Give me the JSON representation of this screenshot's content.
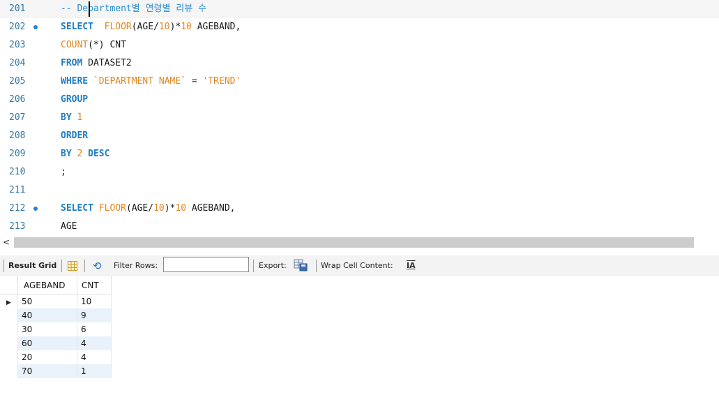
{
  "editor": {
    "lines": [
      {
        "no": "201",
        "marker": false,
        "current": true,
        "tokens": [
          {
            "t": "cm",
            "v": "-- Department별 연령별 리뷰 수"
          }
        ]
      },
      {
        "no": "202",
        "marker": true,
        "current": false,
        "tokens": [
          {
            "t": "kw",
            "v": "SELECT"
          },
          {
            "t": "id",
            "v": "  "
          },
          {
            "t": "fn",
            "v": "FLOOR"
          },
          {
            "t": "id",
            "v": "(AGE/"
          },
          {
            "t": "num",
            "v": "10"
          },
          {
            "t": "id",
            "v": ")*"
          },
          {
            "t": "num",
            "v": "10"
          },
          {
            "t": "id",
            "v": " AGEBAND,"
          }
        ]
      },
      {
        "no": "203",
        "marker": false,
        "current": false,
        "tokens": [
          {
            "t": "fn",
            "v": "COUNT"
          },
          {
            "t": "id",
            "v": "(*) CNT"
          }
        ]
      },
      {
        "no": "204",
        "marker": false,
        "current": false,
        "tokens": [
          {
            "t": "kw",
            "v": "FROM"
          },
          {
            "t": "id",
            "v": " DATASET2"
          }
        ]
      },
      {
        "no": "205",
        "marker": false,
        "current": false,
        "tokens": [
          {
            "t": "kw",
            "v": "WHERE"
          },
          {
            "t": "id",
            "v": " "
          },
          {
            "t": "str",
            "v": "`DEPARTMENT NAME`"
          },
          {
            "t": "id",
            "v": " = "
          },
          {
            "t": "str",
            "v": "'TREND'"
          }
        ]
      },
      {
        "no": "206",
        "marker": false,
        "current": false,
        "tokens": [
          {
            "t": "kw",
            "v": "GROUP"
          }
        ]
      },
      {
        "no": "207",
        "marker": false,
        "current": false,
        "tokens": [
          {
            "t": "kw",
            "v": "BY"
          },
          {
            "t": "id",
            "v": " "
          },
          {
            "t": "num",
            "v": "1"
          }
        ]
      },
      {
        "no": "208",
        "marker": false,
        "current": false,
        "tokens": [
          {
            "t": "kw",
            "v": "ORDER"
          }
        ]
      },
      {
        "no": "209",
        "marker": false,
        "current": false,
        "tokens": [
          {
            "t": "kw",
            "v": "BY"
          },
          {
            "t": "id",
            "v": " "
          },
          {
            "t": "num",
            "v": "2"
          },
          {
            "t": "id",
            "v": " "
          },
          {
            "t": "kw",
            "v": "DESC"
          }
        ]
      },
      {
        "no": "210",
        "marker": false,
        "current": false,
        "tokens": [
          {
            "t": "id",
            "v": ";"
          }
        ]
      },
      {
        "no": "211",
        "marker": false,
        "current": false,
        "tokens": []
      },
      {
        "no": "212",
        "marker": true,
        "current": false,
        "tokens": [
          {
            "t": "kw",
            "v": "SELECT"
          },
          {
            "t": "id",
            "v": " "
          },
          {
            "t": "fn",
            "v": "FLOOR"
          },
          {
            "t": "id",
            "v": "(AGE/"
          },
          {
            "t": "num",
            "v": "10"
          },
          {
            "t": "id",
            "v": ")*"
          },
          {
            "t": "num",
            "v": "10"
          },
          {
            "t": "id",
            "v": " AGEBAND,"
          }
        ]
      },
      {
        "no": "213",
        "marker": false,
        "current": false,
        "tokens": [
          {
            "t": "id",
            "v": "AGE"
          }
        ]
      }
    ]
  },
  "scrollbar": {
    "left_arrow": "<"
  },
  "toolbar": {
    "result_grid_label": "Result Grid",
    "filter_rows_label": "Filter Rows:",
    "filter_value": "",
    "export_label": "Export:",
    "wrap_label": "Wrap Cell Content:",
    "wrap_icon_glyph": "IA"
  },
  "grid": {
    "columns": [
      "AGEBAND",
      "CNT"
    ],
    "rows": [
      [
        "50",
        "10"
      ],
      [
        "40",
        "9"
      ],
      [
        "30",
        "6"
      ],
      [
        "60",
        "4"
      ],
      [
        "20",
        "4"
      ],
      [
        "70",
        "1"
      ]
    ],
    "row_pointer": "▶"
  }
}
